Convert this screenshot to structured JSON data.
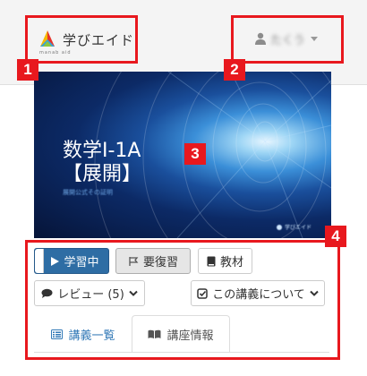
{
  "header": {
    "logo_text": "学びエイド",
    "logo_subtext": "manab aid",
    "user_name": "たくう"
  },
  "video": {
    "title_line1": "数学Ⅰ-1A",
    "title_line2": "【展開】",
    "subtitle": "展開公式その証明",
    "brand": "学びエイド"
  },
  "controls": {
    "learning_label": "学習中",
    "review_label": "要復習",
    "material_label": "教材",
    "reviews_label": "レビュー (5)",
    "about_label": "この講義について"
  },
  "tabs": [
    {
      "label": "講義一覧"
    },
    {
      "label": "講座情報"
    }
  ],
  "annotations": [
    {
      "label": "1"
    },
    {
      "label": "2"
    },
    {
      "label": "3"
    },
    {
      "label": "4"
    }
  ],
  "colors": {
    "annotation": "#e8181e",
    "primary": "#2e6da4",
    "link": "#337ab7"
  }
}
